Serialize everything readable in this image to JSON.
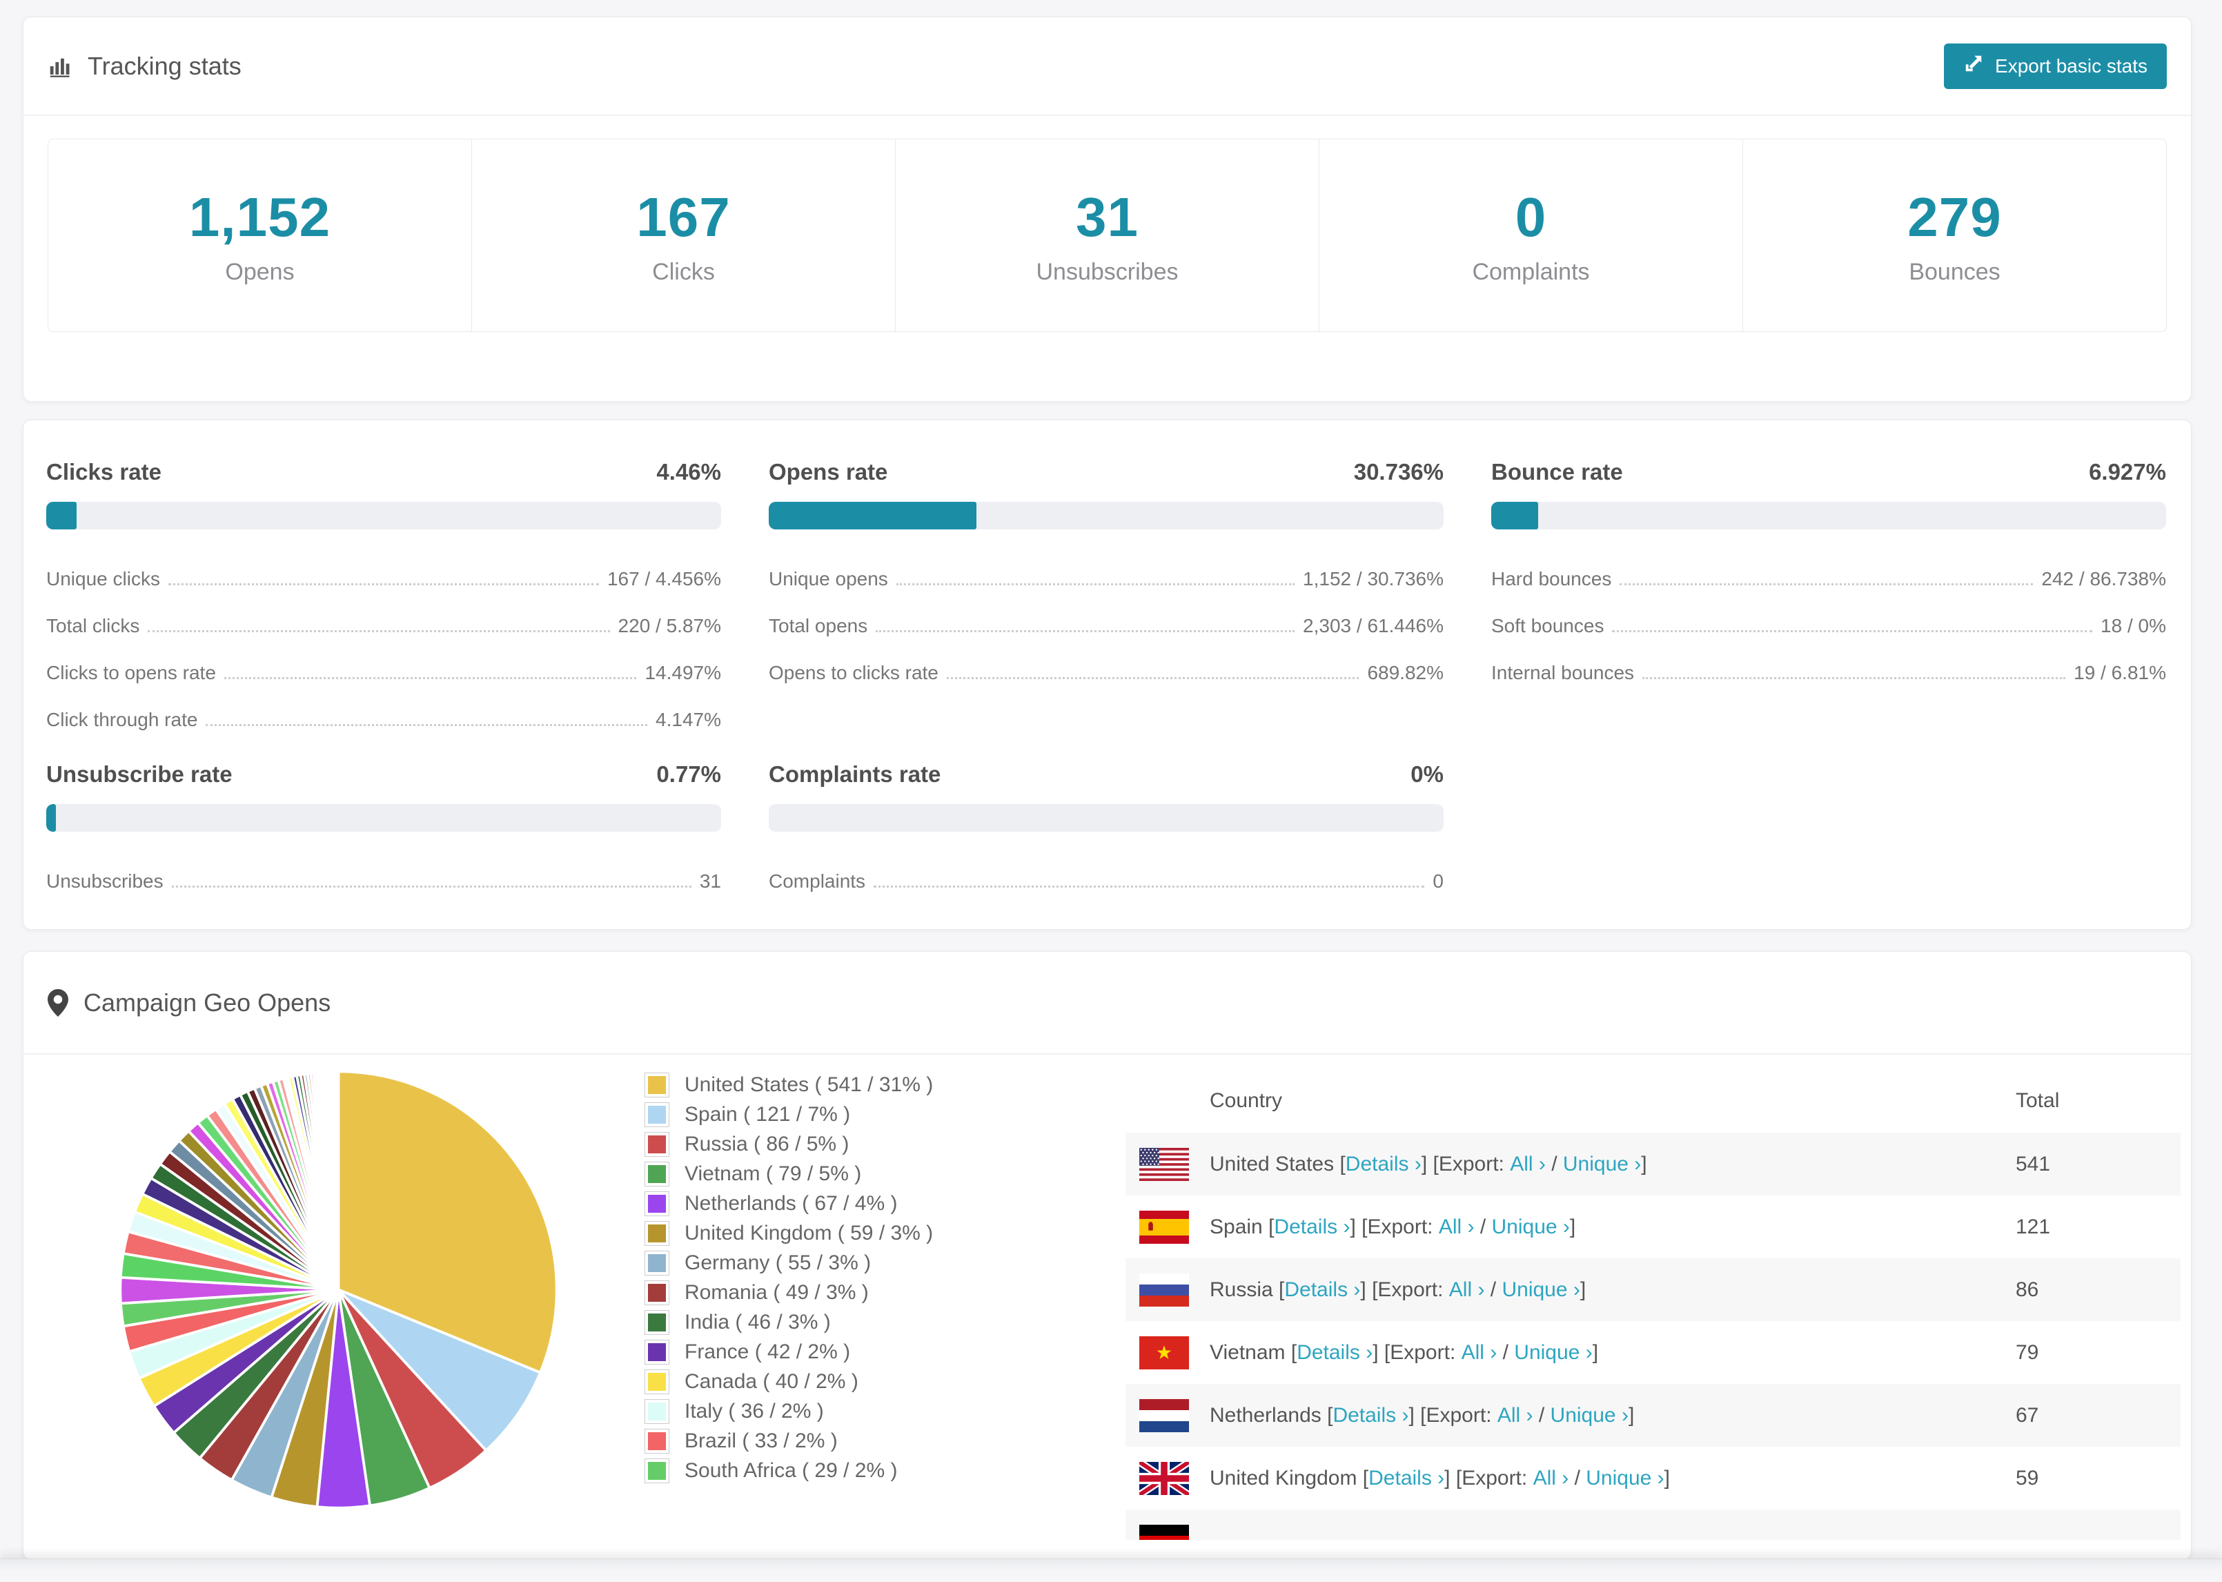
{
  "colors": {
    "accent": "#1b8ea6",
    "link": "#2da5c0",
    "page_bg": "#f6f6f8"
  },
  "tracking_card": {
    "title": "Tracking stats",
    "export_button_label": "Export basic stats",
    "stats": [
      {
        "value": "1,152",
        "label": "Opens"
      },
      {
        "value": "167",
        "label": "Clicks"
      },
      {
        "value": "31",
        "label": "Unsubscribes"
      },
      {
        "value": "0",
        "label": "Complaints"
      },
      {
        "value": "279",
        "label": "Bounces"
      }
    ]
  },
  "rates_card": {
    "sections": [
      {
        "title": "Clicks rate",
        "value": "4.46%",
        "progress_percent": 4.46,
        "rows": [
          {
            "label": "Unique clicks",
            "value": "167 / 4.456%"
          },
          {
            "label": "Total clicks",
            "value": "220 / 5.87%"
          },
          {
            "label": "Clicks to opens rate",
            "value": "14.497%"
          },
          {
            "label": "Click through rate",
            "value": "4.147%"
          }
        ]
      },
      {
        "title": "Opens rate",
        "value": "30.736%",
        "progress_percent": 30.736,
        "rows": [
          {
            "label": "Unique opens",
            "value": "1,152 / 30.736%"
          },
          {
            "label": "Total opens",
            "value": "2,303 / 61.446%"
          },
          {
            "label": "Opens to clicks rate",
            "value": "689.82%"
          }
        ]
      },
      {
        "title": "Bounce rate",
        "value": "6.927%",
        "progress_percent": 6.927,
        "rows": [
          {
            "label": "Hard bounces",
            "value": "242 / 86.738%"
          },
          {
            "label": "Soft bounces",
            "value": "18 / 0%"
          },
          {
            "label": "Internal bounces",
            "value": "19 / 6.81%"
          }
        ]
      },
      {
        "title": "Unsubscribe rate",
        "value": "0.77%",
        "progress_percent": 0.77,
        "rows": [
          {
            "label": "Unsubscribes",
            "value": "31"
          }
        ]
      },
      {
        "title": "Complaints rate",
        "value": "0%",
        "progress_percent": 0,
        "rows": [
          {
            "label": "Complaints",
            "value": "0"
          }
        ]
      }
    ]
  },
  "geo_card": {
    "title": "Campaign Geo Opens",
    "chart_data": {
      "type": "pie",
      "title": "Campaign Geo Opens",
      "unit": "opens",
      "labels": [
        "United States",
        "Spain",
        "Russia",
        "Vietnam",
        "Netherlands",
        "United Kingdom",
        "Germany",
        "Romania",
        "India",
        "France",
        "Canada",
        "Italy",
        "Brazil",
        "South Africa"
      ],
      "values": [
        541,
        121,
        86,
        79,
        67,
        59,
        55,
        49,
        46,
        42,
        40,
        36,
        33,
        29
      ],
      "percent_labels": [
        31,
        7,
        5,
        5,
        4,
        3,
        3,
        3,
        3,
        2,
        2,
        2,
        2,
        2
      ],
      "colors": [
        "#e9c349",
        "#aed6f2",
        "#cd4d4e",
        "#4fa553",
        "#9b45ef",
        "#b6952c",
        "#8fb4ce",
        "#a33d3b",
        "#3a7a3f",
        "#6a34ae",
        "#f9e046",
        "#dcfcf8",
        "#f26465",
        "#65cd68"
      ],
      "start_angle_deg": -90,
      "direction": "clockwise",
      "legend_position": "right",
      "others": {
        "description": "long tail of small unlabeled country slices",
        "approx_percent_total": 26,
        "slice_count": 45,
        "decay": 0.93,
        "colors": [
          "#cb52e5",
          "#5bd465",
          "#f26c6d",
          "#e4fbfb",
          "#f8f34e",
          "#453086",
          "#2d6f34",
          "#7d2727",
          "#6e8da4",
          "#9d8c27",
          "#d550e4",
          "#68da75",
          "#f58b8b",
          "#effcff",
          "#fbfb6b",
          "#352b6f",
          "#255d29",
          "#5f2121",
          "#8ba1b6",
          "#b4a534",
          "#e16be9",
          "#7de18b",
          "#f8a1a1",
          "#f7feff",
          "#fdfd8b",
          "#4b3b9b",
          "#2b7b36",
          "#8b3636",
          "#a1b6c9",
          "#c5b643",
          "#f08bf3",
          "#99eda5",
          "#fbb9b9",
          "#ffffff",
          "#fefea9",
          "#5b4baf",
          "#369340",
          "#a14646",
          "#b9ccd9",
          "#d6c954",
          "#f6a9f9",
          "#b3f7bd",
          "#fed1d1",
          "#fefefe",
          "#fefec9"
        ]
      }
    },
    "legend": [
      {
        "text": "United States ( 541 / 31% )"
      },
      {
        "text": "Spain ( 121 / 7% )"
      },
      {
        "text": "Russia ( 86 / 5% )"
      },
      {
        "text": "Vietnam ( 79 / 5% )"
      },
      {
        "text": "Netherlands ( 67 / 4% )"
      },
      {
        "text": "United Kingdom ( 59 / 3% )"
      },
      {
        "text": "Germany ( 55 / 3% )"
      },
      {
        "text": "Romania ( 49 / 3% )"
      },
      {
        "text": "India ( 46 / 3% )"
      },
      {
        "text": "France ( 42 / 2% )"
      },
      {
        "text": "Canada ( 40 / 2% )"
      },
      {
        "text": "Italy ( 36 / 2% )"
      },
      {
        "text": "Brazil ( 33 / 2% )"
      },
      {
        "text": "South Africa ( 29 / 2% )"
      }
    ],
    "table": {
      "headers": [
        "Country",
        "Total"
      ],
      "link_labels": {
        "lb": " [",
        "details": "Details ›",
        "mid": "] [",
        "export": "Export: ",
        "all": "All ›",
        "slash": " / ",
        "unique": "Unique ›",
        "rb": "]"
      },
      "rows": [
        {
          "flag": "us",
          "country": "United States",
          "total": "541"
        },
        {
          "flag": "es",
          "country": "Spain",
          "total": "121"
        },
        {
          "flag": "ru",
          "country": "Russia",
          "total": "86"
        },
        {
          "flag": "vn",
          "country": "Vietnam",
          "total": "79"
        },
        {
          "flag": "nl",
          "country": "Netherlands",
          "total": "67"
        },
        {
          "flag": "gb",
          "country": "United Kingdom",
          "total": "59"
        },
        {
          "flag": "de",
          "country": "",
          "total": ""
        }
      ]
    }
  }
}
